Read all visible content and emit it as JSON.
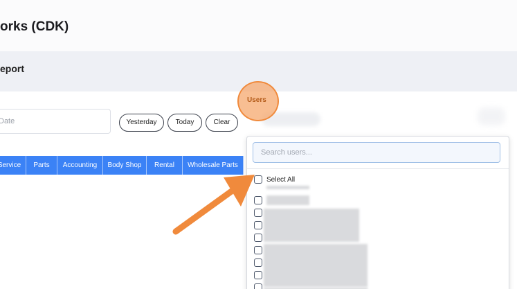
{
  "header": {
    "title": "orks (CDK)"
  },
  "section": {
    "title": "eport"
  },
  "filters": {
    "date_placeholder": "Date",
    "quick_buttons": [
      "Yesterday",
      "Today",
      "Clear"
    ]
  },
  "tabs": [
    "Service",
    "Parts",
    "Accounting",
    "Body Shop",
    "Rental",
    "Wholesale Parts"
  ],
  "users_filter": {
    "label": "Users",
    "search_placeholder": "Search users...",
    "select_all_label": "Select All",
    "options_visible": 9
  },
  "annotation": {
    "arrow_color": "#f08a3c",
    "highlight_color": "#f6a86e"
  },
  "colors": {
    "tab_blue": "#3b82f6"
  }
}
